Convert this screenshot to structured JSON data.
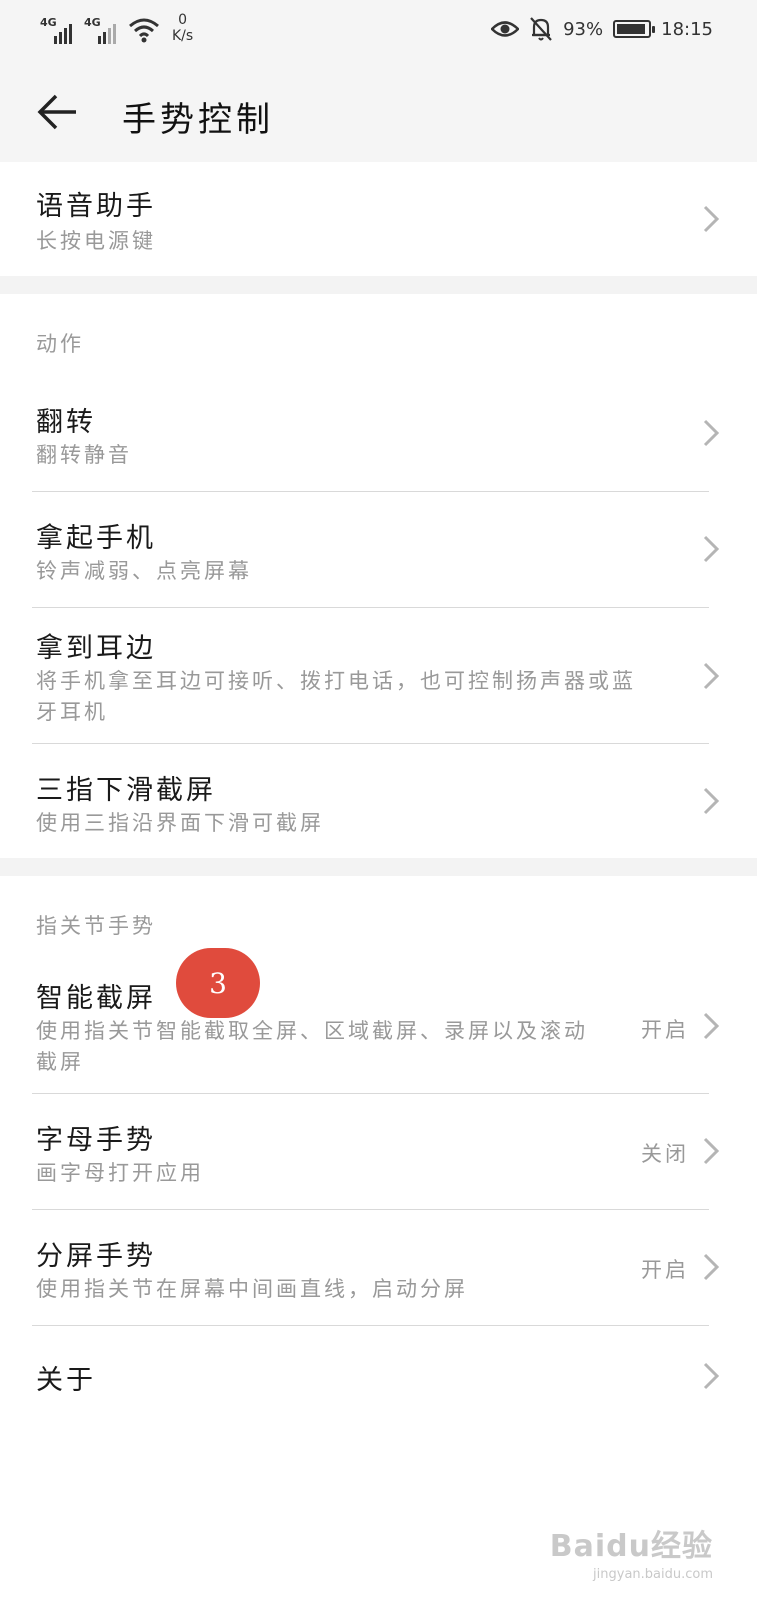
{
  "status_bar": {
    "net1": "4G",
    "net2": "4G",
    "speed_value": "0",
    "speed_unit": "K/s",
    "battery_percent": "93%",
    "battery_level": 0.93,
    "time": "18:15"
  },
  "header": {
    "title": "手势控制"
  },
  "voice": {
    "title": "语音助手",
    "subtitle": "长按电源键"
  },
  "actions": {
    "section_label": "动作",
    "items": [
      {
        "title": "翻转",
        "subtitle": "翻转静音"
      },
      {
        "title": "拿起手机",
        "subtitle": "铃声减弱、点亮屏幕"
      },
      {
        "title": "拿到耳边",
        "subtitle": "将手机拿至耳边可接听、拨打电话，也可控制扬声器或蓝牙耳机"
      },
      {
        "title": "三指下滑截屏",
        "subtitle": "使用三指沿界面下滑可截屏"
      }
    ]
  },
  "knuckle": {
    "section_label": "指关节手势",
    "items": [
      {
        "title": "智能截屏",
        "subtitle": "使用指关节智能截取全屏、区域截屏、录屏以及滚动截屏",
        "state": "开启"
      },
      {
        "title": "字母手势",
        "subtitle": "画字母打开应用",
        "state": "关闭"
      },
      {
        "title": "分屏手势",
        "subtitle": "使用指关节在屏幕中间画直线，启动分屏",
        "state": "开启"
      }
    ]
  },
  "about": {
    "title": "关于"
  },
  "annotation": {
    "badge": "3"
  },
  "watermark": {
    "main": "Baidu经验",
    "sub": "jingyan.baidu.com"
  },
  "colors": {
    "badge": "#e04b3d",
    "page_bg": "#ffffff",
    "gap_bg": "#f3f3f3",
    "secondary_text": "#999999"
  }
}
